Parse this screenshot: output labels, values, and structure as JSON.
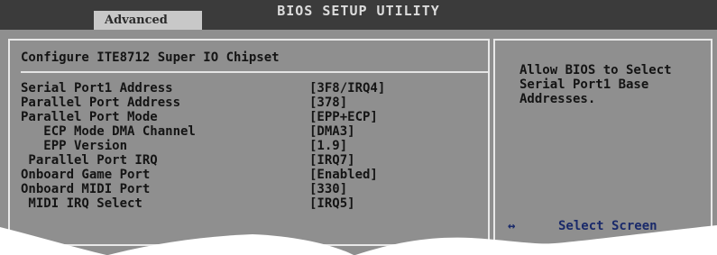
{
  "window": {
    "title": "BIOS SETUP UTILITY",
    "active_tab": "Advanced"
  },
  "main": {
    "header": "Configure ITE8712 Super IO Chipset",
    "settings": [
      {
        "label": "Serial Port1 Address",
        "value": "[3F8/IRQ4]"
      },
      {
        "label": "Parallel Port Address",
        "value": "[378]"
      },
      {
        "label": "Parallel Port Mode",
        "value": "[EPP+ECP]"
      },
      {
        "label": "   ECP Mode DMA Channel",
        "value": "[DMA3]"
      },
      {
        "label": "   EPP Version",
        "value": "[1.9]"
      },
      {
        "label": " Parallel Port IRQ",
        "value": "[IRQ7]"
      },
      {
        "label": "Onboard Game Port",
        "value": "[Enabled]"
      },
      {
        "label": "Onboard MIDI Port",
        "value": "[330]"
      },
      {
        "label": " MIDI IRQ Select",
        "value": "[IRQ5]"
      }
    ]
  },
  "help": {
    "lines": [
      "Allow BIOS to Select",
      "Serial Port1 Base",
      "Addresses."
    ],
    "key_hint": {
      "key": "↔",
      "label": "Select Screen"
    }
  },
  "colors": {
    "background": "#8f8f8f",
    "titlebar": "#3b3b3b",
    "tab": "#c8c8c8",
    "key_hint": "#1a2a6a"
  }
}
